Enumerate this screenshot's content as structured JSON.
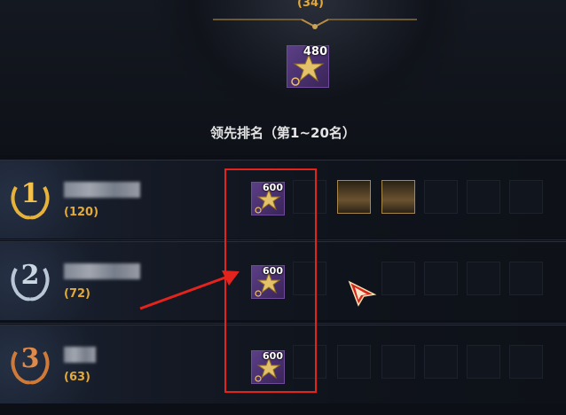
{
  "header": {
    "top_count": "(34)",
    "top_reward_qty": "480"
  },
  "ranking": {
    "title": "领先排名（第1~20名）",
    "rows": [
      {
        "rank": "1",
        "score": "(120)",
        "reward_qty": "600",
        "medal_color": "#e7b23a"
      },
      {
        "rank": "2",
        "score": "(72)",
        "reward_qty": "600",
        "medal_color": "#b9c6d6"
      },
      {
        "rank": "3",
        "score": "(63)",
        "reward_qty": "600",
        "medal_color": "#d07a3a"
      }
    ]
  },
  "colors": {
    "accent_gold": "#e2a93b",
    "highlight_red": "#e4241c",
    "reward_purple": "#5b3f86"
  },
  "icons": {
    "reward": "star-item-icon",
    "cursor": "red-pointer-cursor-icon",
    "medal": "laurel-medal-icon"
  }
}
